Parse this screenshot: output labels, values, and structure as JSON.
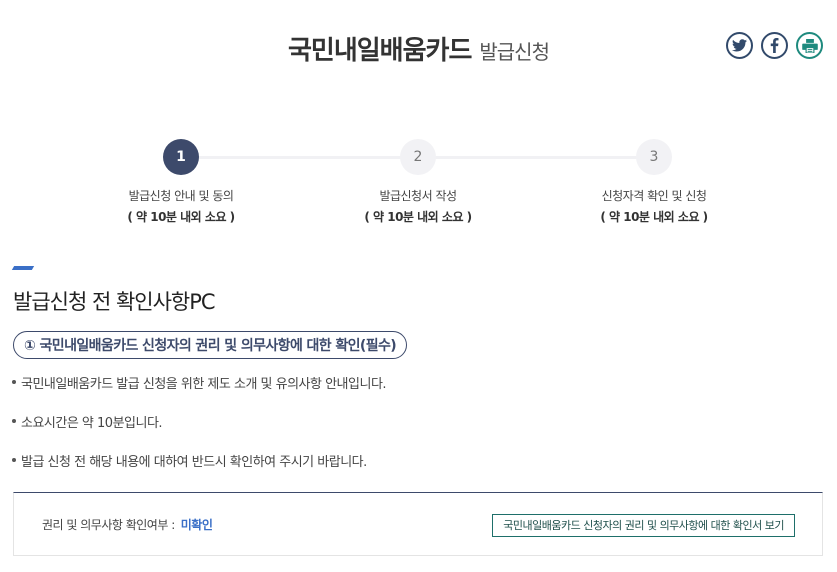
{
  "header": {
    "title_main": "국민내일배움카드",
    "title_sub": "발급신청",
    "share_icons": [
      "twitter-icon",
      "facebook-icon",
      "print-icon"
    ]
  },
  "steps": [
    {
      "number": "1",
      "label": "발급신청 안내 및 동의",
      "time": "( 약 10분 내외 소요 )",
      "active": true
    },
    {
      "number": "2",
      "label": "발급신청서 작성",
      "time": "( 약 10분 내외 소요 )",
      "active": false
    },
    {
      "number": "3",
      "label": "신청자격 확인 및 신청",
      "time": "( 약 10분 내외 소요 )",
      "active": false
    }
  ],
  "section": {
    "title": "발급신청 전 확인사항PC",
    "pill": "① 국민내일배움카드 신청자의 권리 및 의무사항에 대한 확인(필수)",
    "bullets": [
      "국민내일배움카드 발급 신청을 위한 제도 소개 및 유의사항 안내입니다.",
      "소요시간은 약 10분입니다.",
      "발급 신청 전 해당 내용에 대하여 반드시 확인하여 주시기 바랍니다."
    ]
  },
  "confirm": {
    "label": "권리 및 의무사항 확인여부 :",
    "status": "미확인",
    "button_label": "국민내일배움카드 신청자의 권리 및 의무사항에 대한 확인서 보기"
  },
  "colors": {
    "primary_navy": "#3d4a6b",
    "accent_blue": "#3a6fc7",
    "print_teal": "#1e8a7e"
  }
}
